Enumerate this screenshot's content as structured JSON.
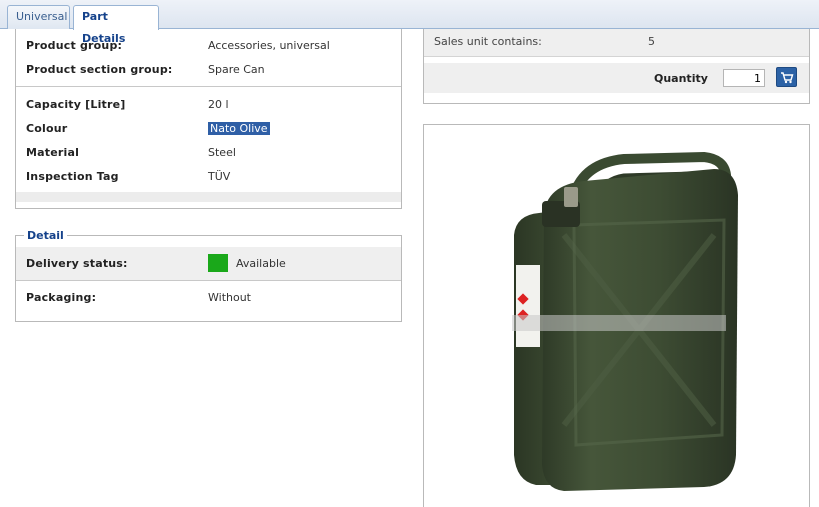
{
  "tabs": [
    {
      "label": "Universal"
    },
    {
      "label": "Part Details"
    }
  ],
  "attributes": {
    "product_group": {
      "label": "Product group:",
      "value": "Accessories, universal"
    },
    "product_section_group": {
      "label": "Product section group:",
      "value": "Spare Can"
    },
    "capacity": {
      "label": "Capacity [Litre]",
      "value": "20 l"
    },
    "colour": {
      "label": "Colour",
      "value": "Nato Olive"
    },
    "material": {
      "label": "Material",
      "value": "Steel"
    },
    "inspection_tag": {
      "label": "Inspection Tag",
      "value": "TÜV"
    }
  },
  "detail": {
    "legend": "Detail",
    "delivery_status": {
      "label": "Delivery status:",
      "value": "Available",
      "color": "#1aa81a"
    },
    "packaging": {
      "label": "Packaging:",
      "value": "Without"
    }
  },
  "sales": {
    "unit_label": "Sales unit contains:",
    "unit_value": "5",
    "quantity_label": "Quantity",
    "quantity_value": "1",
    "cart_icon": "cart-icon"
  },
  "product_image": {
    "subject": "jerry-can",
    "color": "#3b4a33"
  }
}
